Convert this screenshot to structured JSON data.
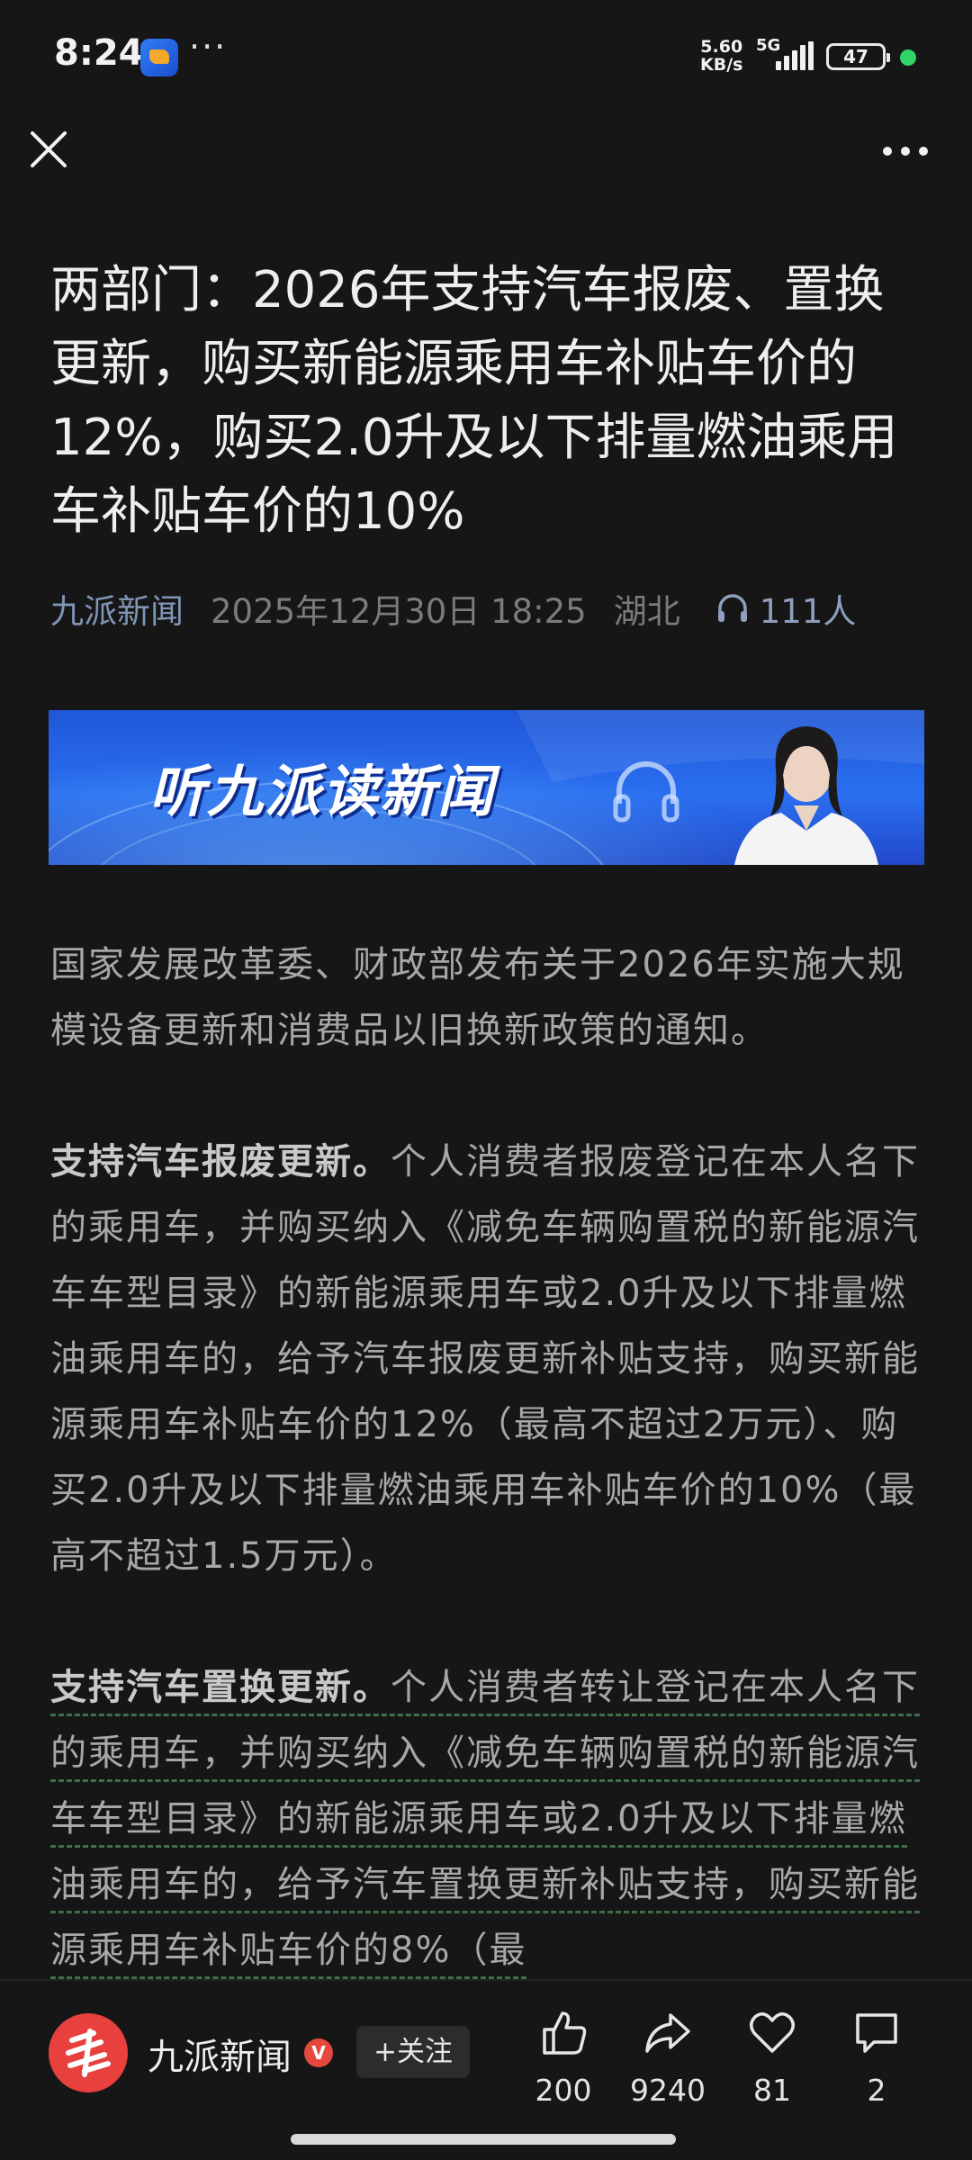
{
  "status_bar": {
    "time": "8:24",
    "more_dots": "···",
    "net_speed_value": "5.60",
    "net_speed_unit": "KB/s",
    "network": "5G",
    "battery": "47"
  },
  "article": {
    "title": "两部门：2026年支持汽车报废、置换更新，购买新能源乘用车补贴车价的12%，购买2.0升及以下排量燃油乘用车补贴车价的10%",
    "source": "九派新闻",
    "datetime": "2025年12月30日 18:25",
    "region": "湖北",
    "listeners": "111人",
    "banner_text": "听九派读新闻",
    "paragraphs": [
      {
        "lead": "",
        "text": "国家发展改革委、财政部发布关于2026年实施大规模设备更新和消费品以旧换新政策的通知。"
      },
      {
        "lead": "支持汽车报废更新。",
        "text": "个人消费者报废登记在本人名下的乘用车，并购买纳入《减免车辆购置税的新能源汽车车型目录》的新能源乘用车或2.0升及以下排量燃油乘用车的，给予汽车报废更新补贴支持，购买新能源乘用车补贴车价的12%（最高不超过2万元）、购买2.0升及以下排量燃油乘用车补贴车价的10%（最高不超过1.5万元）。"
      },
      {
        "lead": "支持汽车置换更新。",
        "text": "个人消费者转让登记在本人名下的乘用车，并购买纳入《减免车辆购置税的新能源汽车车型目录》的新能源乘用车或2.0升及以下排量燃油乘用车的，给予汽车置换更新补贴支持，购买新能源乘用车补贴车价的8%（最"
      }
    ]
  },
  "bottom_bar": {
    "author": "九派新闻",
    "verified_mark": "V",
    "follow_label": "+关注",
    "likes": "200",
    "shares": "9240",
    "favorites": "81",
    "comments": "2"
  },
  "colors": {
    "background": "#161616",
    "link_blue": "#7f95b6",
    "brand_red": "#e8403d",
    "banner_blue": "#2a6ff0"
  }
}
